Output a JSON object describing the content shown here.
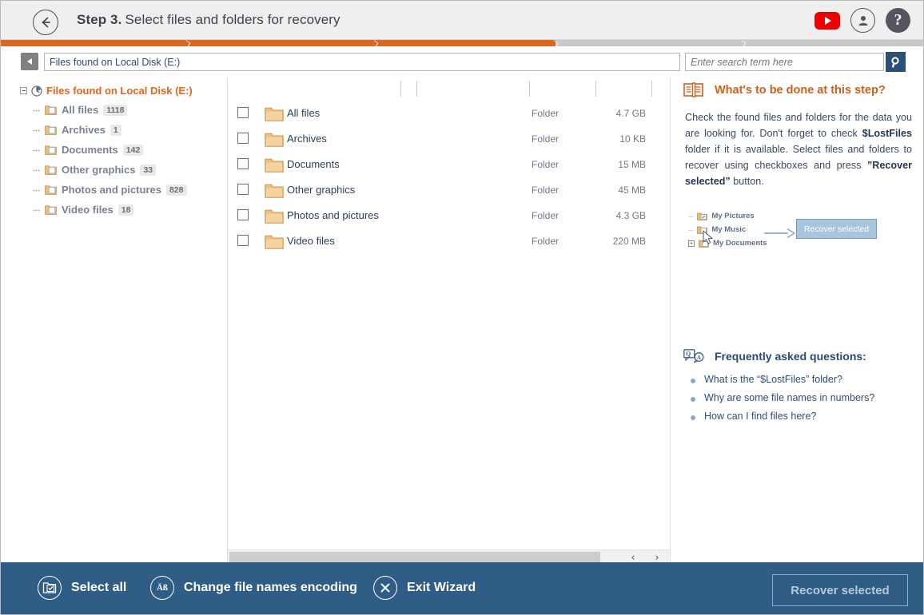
{
  "header": {
    "back_icon": "back-arrow-icon",
    "step_number": "Step 3.",
    "step_title": "Select files and folders for recovery",
    "youtube_icon": "youtube-icon",
    "account_icon": "user-account-icon",
    "help_icon": "help-icon",
    "help_glyph": "?"
  },
  "progress": {
    "fill_percent": 60,
    "fill_color": "#da6722",
    "track_color": "#c9c9c9",
    "dividers_percent": [
      19.9,
      40.2,
      60.0,
      80.0
    ]
  },
  "addressbar": {
    "nav_back_icon": "nav-back-icon",
    "path_value": "Files found on Local Disk (E:)",
    "search_value": "",
    "search_placeholder": "Enter search term here",
    "search_button_icon": "search-icon"
  },
  "tree": {
    "root": {
      "label": "Files found on Local Disk (E:)",
      "icon": "scan-clock-icon",
      "expanded": true
    },
    "items": [
      {
        "label": "All files",
        "count": "1118",
        "icon": "folder-icon"
      },
      {
        "label": "Archives",
        "count": "1",
        "icon": "folder-icon"
      },
      {
        "label": "Documents",
        "count": "142",
        "icon": "folder-icon"
      },
      {
        "label": "Other graphics",
        "count": "33",
        "icon": "folder-icon"
      },
      {
        "label": "Photos and pictures",
        "count": "828",
        "icon": "folder-icon"
      },
      {
        "label": "Video files",
        "count": "18",
        "icon": "folder-icon"
      }
    ]
  },
  "filelist": {
    "columns": [
      "",
      "",
      "",
      "",
      ""
    ],
    "rows": [
      {
        "name": "All files",
        "type": "Folder",
        "size": "4.7 GB",
        "checked": false,
        "icon": "folder-icon"
      },
      {
        "name": "Archives",
        "type": "Folder",
        "size": "10 KB",
        "checked": false,
        "icon": "folder-icon"
      },
      {
        "name": "Documents",
        "type": "Folder",
        "size": "15 MB",
        "checked": false,
        "icon": "folder-icon"
      },
      {
        "name": "Other graphics",
        "type": "Folder",
        "size": "45 MB",
        "checked": false,
        "icon": "folder-icon"
      },
      {
        "name": "Photos and pictures",
        "type": "Folder",
        "size": "4.3 GB",
        "checked": false,
        "icon": "folder-icon"
      },
      {
        "name": "Video files",
        "type": "Folder",
        "size": "220 MB",
        "checked": false,
        "icon": "folder-icon"
      }
    ],
    "scroll_left_icon": "chevron-left-icon",
    "scroll_right_icon": "chevron-right-icon",
    "scroll_left_glyph": "‹",
    "scroll_right_glyph": "›"
  },
  "right_panel": {
    "book_icon": "open-book-icon",
    "title": "What's to be done at this step?",
    "body_1": "Check the found files and folders for the data you are looking for. Don't forget to check ",
    "body_bold_1": "$LostFiles",
    "body_2": " folder if it is available. Select files and folders to recover using checkboxes and press ",
    "body_bold_2": "”Recover selected”",
    "body_3": " button.",
    "illustration": {
      "item_1": "My Pictures",
      "item_2": "My Music",
      "item_3": "My Documents",
      "arrow_icon": "right-arrow-icon",
      "button_label": "Recover selected"
    },
    "faq_icon": "question-answer-icon",
    "faq_title": "Frequently asked questions:",
    "faq_items": [
      "What is the “$LostFiles” folder?",
      "Why are some file names in numbers?",
      "How can I find files here?"
    ]
  },
  "bottom_bar": {
    "select_all_icon": "select-all-icon",
    "select_all_label": "Select all",
    "encoding_icon": "encoding-icon",
    "encoding_glyph": "Äß",
    "encoding_label": "Change file names encoding",
    "exit_icon": "close-x-icon",
    "exit_label": "Exit Wizard",
    "recover_label": "Recover selected"
  },
  "colors": {
    "accent_orange": "#da6722",
    "bottom_bar_blue": "#2f5d86",
    "header_gray": "#efefef",
    "text_blue": "#2c3e5a"
  }
}
